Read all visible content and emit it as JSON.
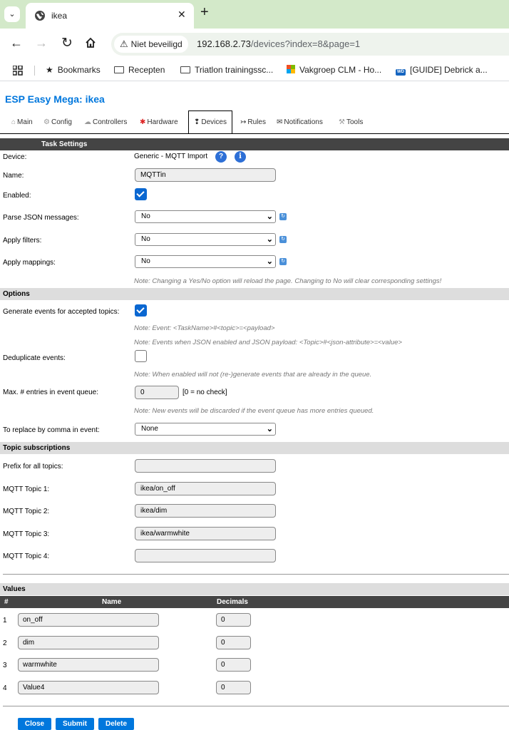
{
  "browser": {
    "tab_title": "ikea",
    "security_label": "Niet beveiligd",
    "url_host": "192.168.2.73",
    "url_path": "/devices?index=8&page=1",
    "bookmarks": [
      "Bookmarks",
      "Recepten",
      "Triatlon trainingssc...",
      "Vakgroep CLM - Ho...",
      "[GUIDE] Debrick a..."
    ]
  },
  "page": {
    "title": "ESP Easy Mega: ikea",
    "menu": [
      "Main",
      "Config",
      "Controllers",
      "Hardware",
      "Devices",
      "Rules",
      "Notifications",
      "Tools"
    ],
    "menu_icons": [
      "⌂",
      "⚙",
      "☁",
      "📌",
      "💡",
      "⤳",
      "✉",
      "🔧"
    ],
    "active_menu": "Devices"
  },
  "task": {
    "header": "Task Settings",
    "device_label": "Device:",
    "device_value": "Generic - MQTT Import",
    "help_icon": "?",
    "info_icon": "i",
    "name_label": "Name:",
    "name_value": "MQTTin",
    "enabled_label": "Enabled:",
    "enabled": true,
    "parse_label": "Parse JSON messages:",
    "parse_value": "No",
    "filters_label": "Apply filters:",
    "filters_value": "No",
    "mappings_label": "Apply mappings:",
    "mappings_value": "No",
    "note": "Note: Changing a Yes/No option will reload the page. Changing to No will clear corresponding settings!"
  },
  "options": {
    "header": "Options",
    "gen_events_label": "Generate events for accepted topics:",
    "gen_events": true,
    "note_event": "Note: Event: <TaskName>#<topic>=<payload>",
    "note_json": "Note: Events when JSON enabled and JSON payload: <Topic>#<json-attribute>=<value>",
    "dedup_label": "Deduplicate events:",
    "dedup": false,
    "note_dedup": "Note: When enabled will not (re-)generate events that are already in the queue.",
    "max_label": "Max. # entries in event queue:",
    "max_value": "0",
    "max_hint": "[0 = no check]",
    "note_max": "Note: New events will be discarded if the event queue has more entries queued.",
    "replace_label": "To replace by comma in event:",
    "replace_value": "None"
  },
  "topics": {
    "header": "Topic subscriptions",
    "prefix_label": "Prefix for all topics:",
    "prefix_value": "",
    "items": [
      {
        "label": "MQTT Topic 1:",
        "value": "ikea/on_off"
      },
      {
        "label": "MQTT Topic 2:",
        "value": "ikea/dim"
      },
      {
        "label": "MQTT Topic 3:",
        "value": "ikea/warmwhite"
      },
      {
        "label": "MQTT Topic 4:",
        "value": ""
      }
    ]
  },
  "values": {
    "header": "Values",
    "col_num": "#",
    "col_name": "Name",
    "col_dec": "Decimals",
    "rows": [
      {
        "num": "1",
        "name": "on_off",
        "dec": "0"
      },
      {
        "num": "2",
        "name": "dim",
        "dec": "0"
      },
      {
        "num": "3",
        "name": "warmwhite",
        "dec": "0"
      },
      {
        "num": "4",
        "name": "Value4",
        "dec": "0"
      }
    ]
  },
  "buttons": {
    "close": "Close",
    "submit": "Submit",
    "delete": "Delete"
  },
  "colors": {
    "accent": "#0077dd",
    "header_dark": "#444444",
    "header_light": "#dddddd",
    "tabbar": "#d3e9c9"
  }
}
